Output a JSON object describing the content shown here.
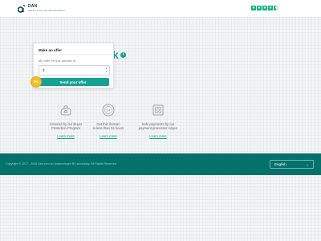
{
  "header": {
    "logo_name": "DAN",
    "logo_tagline": "Get the secure domain transaction",
    "trustpilot_stars": 4.5,
    "icons": {
      "logo": "dan-logo-icon",
      "rating": "trustpilot-star-icon"
    }
  },
  "background": {
    "domain_tail": "k",
    "info_icon": "info-icon"
  },
  "offer": {
    "title": "Make an offer",
    "label": "My offer for this domain is:",
    "currency": "$",
    "amount_value": "",
    "send_label": "Send your offer",
    "badge_text": "PS"
  },
  "features": [
    {
      "line1": "Covered by our Buyer",
      "line2": "Protection Program",
      "link": "Learn more",
      "icon": "buyer-protection-icon"
    },
    {
      "line1": "Get this domain",
      "line2": "in less than 24 hours",
      "link": "Learn more",
      "icon": "24h-clock-icon"
    },
    {
      "line1": "Safe payments by our",
      "line2": "payment processor Adyen",
      "link": "Learn more",
      "icon": "safe-payment-icon"
    }
  ],
  "footer": {
    "copyright": "Copyright © 2017 - 2025 Dan.com an Undeveloped BV subsidiary. All Rights Reserved.",
    "language": "English"
  },
  "colors": {
    "accent": "#16a192",
    "footer": "#04716a",
    "badge": "#f2bf2c",
    "trustpilot": "#00b67a"
  }
}
